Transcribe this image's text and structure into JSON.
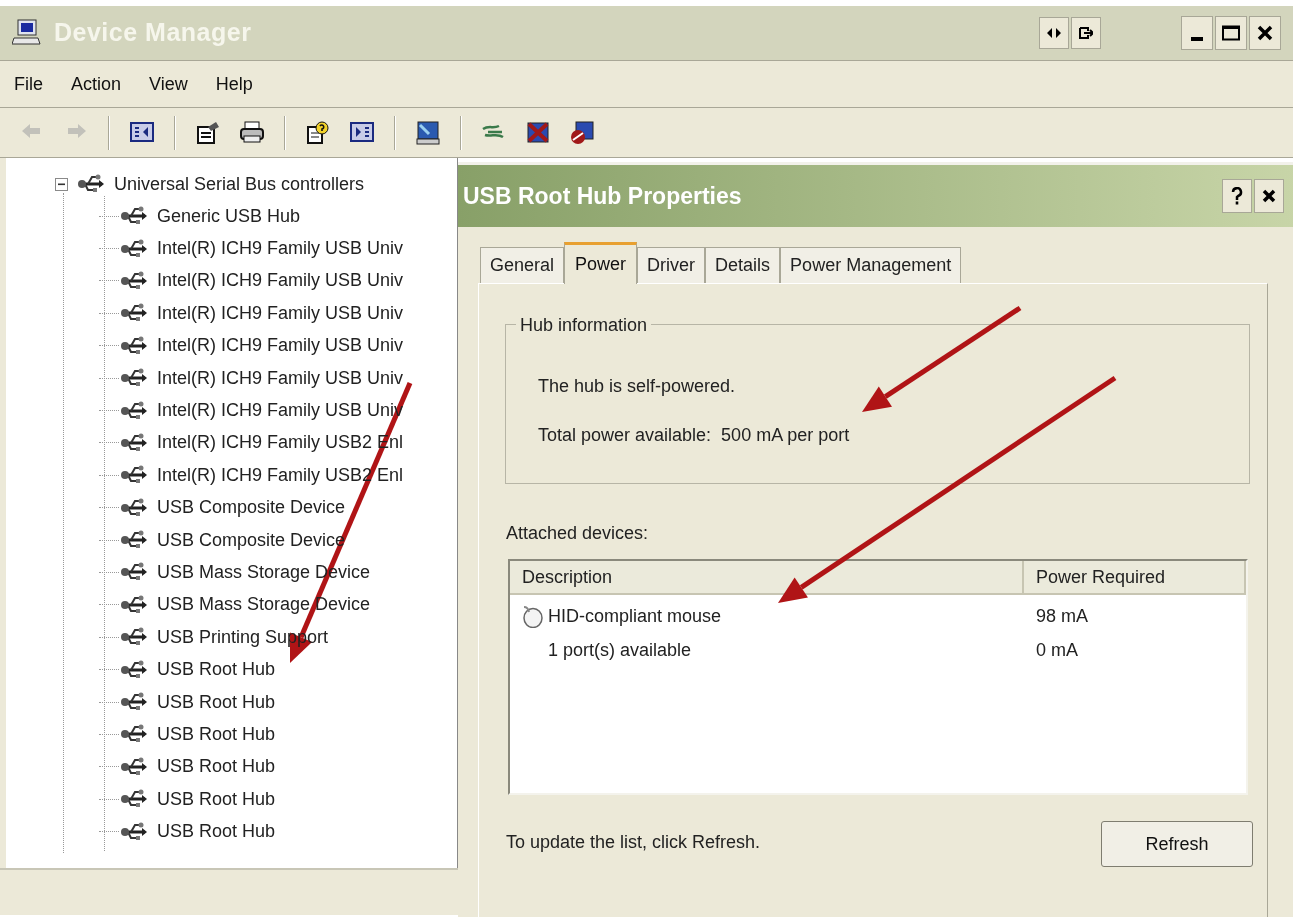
{
  "window": {
    "title": "Device Manager"
  },
  "menu": [
    "File",
    "Action",
    "View",
    "Help"
  ],
  "toolbar": [
    {
      "kind": "back",
      "disabled": true
    },
    {
      "kind": "forward",
      "disabled": true
    },
    {
      "kind": "sep"
    },
    {
      "kind": "tree"
    },
    {
      "kind": "sep"
    },
    {
      "kind": "properties"
    },
    {
      "kind": "print"
    },
    {
      "kind": "sep"
    },
    {
      "kind": "help"
    },
    {
      "kind": "pane"
    },
    {
      "kind": "sep"
    },
    {
      "kind": "scan"
    },
    {
      "kind": "sep"
    },
    {
      "kind": "update"
    },
    {
      "kind": "uninstall"
    },
    {
      "kind": "disable"
    }
  ],
  "tree": {
    "label": "Universal Serial Bus controllers",
    "expanded": true,
    "children": [
      {
        "label": "Generic USB Hub"
      },
      {
        "label": "Intel(R) ICH9 Family USB Univ"
      },
      {
        "label": "Intel(R) ICH9 Family USB Univ"
      },
      {
        "label": "Intel(R) ICH9 Family USB Univ"
      },
      {
        "label": "Intel(R) ICH9 Family USB Univ"
      },
      {
        "label": "Intel(R) ICH9 Family USB Univ"
      },
      {
        "label": "Intel(R) ICH9 Family USB Univ"
      },
      {
        "label": "Intel(R) ICH9 Family USB2 Enl"
      },
      {
        "label": "Intel(R) ICH9 Family USB2 Enl"
      },
      {
        "label": "USB Composite Device"
      },
      {
        "label": "USB Composite Device"
      },
      {
        "label": "USB Mass Storage Device"
      },
      {
        "label": "USB Mass Storage Device"
      },
      {
        "label": "USB Printing Support"
      },
      {
        "label": "USB Root Hub"
      },
      {
        "label": "USB Root Hub"
      },
      {
        "label": "USB Root Hub"
      },
      {
        "label": "USB Root Hub"
      },
      {
        "label": "USB Root Hub"
      },
      {
        "label": "USB Root Hub"
      }
    ]
  },
  "dialog": {
    "title": "USB Root Hub Properties",
    "tabs": [
      {
        "label": "General",
        "selected": false
      },
      {
        "label": "Power",
        "selected": true
      },
      {
        "label": "Driver",
        "selected": false
      },
      {
        "label": "Details",
        "selected": false
      },
      {
        "label": "Power Management",
        "selected": false
      }
    ],
    "hub_information": {
      "title": "Hub information",
      "status": "The hub is self-powered.",
      "power_label": "Total power available:",
      "power_value": "500 mA per port"
    },
    "attached_label": "Attached devices:",
    "columns": [
      "Description",
      "Power Required"
    ],
    "rows": [
      {
        "kind": "device",
        "description": "HID-compliant mouse",
        "power": "98 mA"
      },
      {
        "kind": "port",
        "description": "1 port(s) available",
        "power": "0 mA"
      }
    ],
    "hint": "To update the list, click Refresh.",
    "refresh_button": "Refresh"
  }
}
